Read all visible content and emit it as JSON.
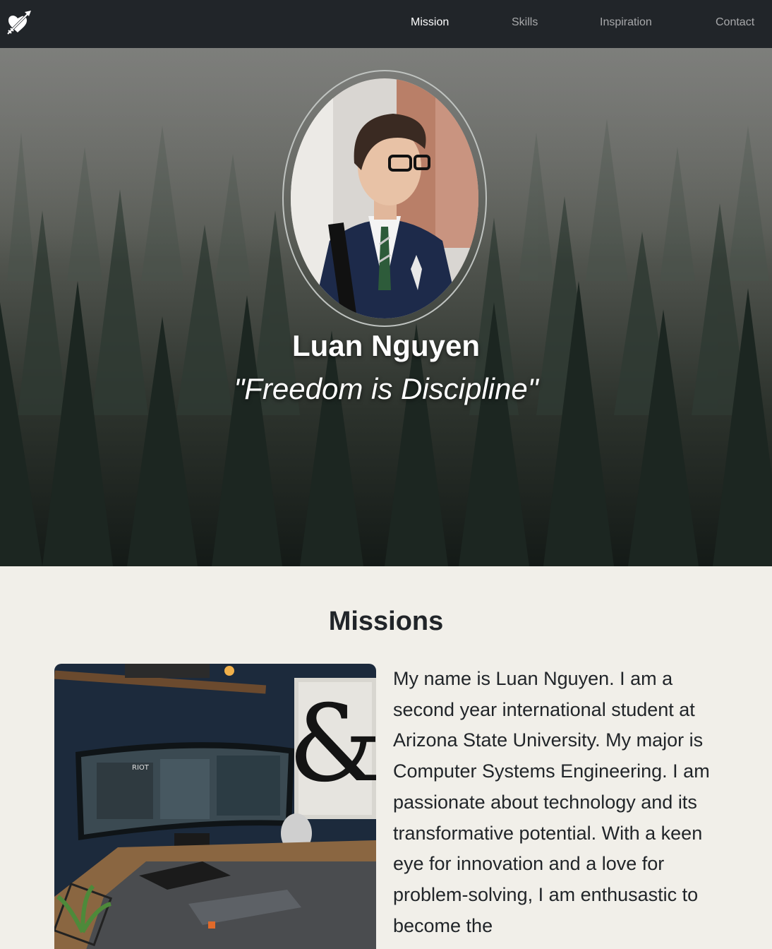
{
  "navbar": {
    "brand_icon": "heart-arrow-icon",
    "links": [
      {
        "label": "Mission",
        "active": true
      },
      {
        "label": "Skills",
        "active": false
      },
      {
        "label": "Inspiration",
        "active": false
      },
      {
        "label": "Contact",
        "active": false
      }
    ]
  },
  "hero": {
    "name": "Luan Nguyen",
    "quote": "\"Freedom is Discipline\""
  },
  "missions": {
    "title": "Missions",
    "text": "My name is Luan Nguyen. I am a second year international student at Arizona State University. My major is Computer Systems Engineering. I am passionate about technology and its transformative potential. With a keen eye for innovation and a love for problem-solving, I am enthusastic to become the"
  },
  "colors": {
    "navbar_bg": "#212529",
    "page_bg": "#f1efe9",
    "text_dark": "#212529"
  }
}
